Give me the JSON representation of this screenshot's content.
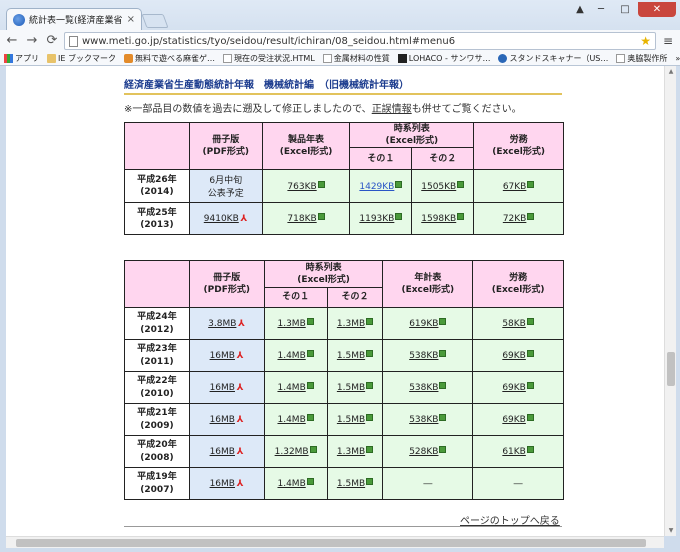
{
  "browser": {
    "tab_title": "統計表一覧(経済産業省生",
    "tab_close": "×",
    "url": "www.meti.go.jp/statistics/tyo/seidou/result/ichiran/08_seidou.html#menu6",
    "bookmarks": [
      "アプリ",
      "IE ブックマーク",
      "無料で遊べる麻雀ゲ…",
      "現在の受注状況.HTML",
      "金属材料の性質",
      "LOHACO - サンワサ…",
      "スタンドスキャナー（US…",
      "奥脇製作所"
    ],
    "bookmarks_more": "»"
  },
  "page": {
    "heading": "経済産業省生産動態統計年報　機械統計編　（旧機械統計年報）",
    "note_before": "※一部品目の数値を過去に遡及して修正しましたので、",
    "note_link": "正誤情報",
    "note_after": "も併せてご覧ください。",
    "top_link": "ページのトップへ戻る"
  },
  "table1": {
    "headers": {
      "pdf": [
        "冊子版",
        "(PDF形式)"
      ],
      "products": [
        "製品年表",
        "(Excel形式)"
      ],
      "timeseries": [
        "時系列表",
        "(Excel形式)"
      ],
      "ts1": "その１",
      "ts2": "その２",
      "labor": [
        "労務",
        "(Excel形式)"
      ]
    },
    "rows": [
      {
        "year": [
          "平成26年",
          "(2014)"
        ],
        "pdf_text": [
          "6月中旬",
          "公表予定"
        ],
        "products": "763KB",
        "ts1": "1429KB",
        "ts2": "1505KB",
        "labor": "67KB"
      },
      {
        "year": [
          "平成25年",
          "(2013)"
        ],
        "pdf": "9410KB",
        "products": "718KB",
        "ts1": "1193KB",
        "ts2": "1598KB",
        "labor": "72KB"
      }
    ]
  },
  "table2": {
    "headers": {
      "pdf": [
        "冊子版",
        "(PDF形式)"
      ],
      "timeseries": [
        "時系列表",
        "(Excel形式)"
      ],
      "ts1": "その１",
      "ts2": "その２",
      "annual": [
        "年計表",
        "(Excel形式)"
      ],
      "labor": [
        "労務",
        "(Excel形式)"
      ]
    },
    "rows": [
      {
        "year": [
          "平成24年",
          "(2012)"
        ],
        "pdf": "3.8MB",
        "ts1": "1.3MB",
        "ts2": "1.3MB",
        "annual": "619KB",
        "labor": "58KB"
      },
      {
        "year": [
          "平成23年",
          "(2011)"
        ],
        "pdf": "16MB",
        "ts1": "1.4MB",
        "ts2": "1.5MB",
        "annual": "538KB",
        "labor": "69KB"
      },
      {
        "year": [
          "平成22年",
          "(2010)"
        ],
        "pdf": "16MB",
        "ts1": "1.4MB",
        "ts2": "1.5MB",
        "annual": "538KB",
        "labor": "69KB"
      },
      {
        "year": [
          "平成21年",
          "(2009)"
        ],
        "pdf": "16MB",
        "ts1": "1.4MB",
        "ts2": "1.5MB",
        "annual": "538KB",
        "labor": "69KB"
      },
      {
        "year": [
          "平成20年",
          "(2008)"
        ],
        "pdf": "16MB",
        "ts1": "1.32MB",
        "ts2": "1.3MB",
        "annual": "528KB",
        "labor": "61KB"
      },
      {
        "year": [
          "平成19年",
          "(2007)"
        ],
        "pdf": "16MB",
        "ts1": "1.4MB",
        "ts2": "1.5MB",
        "annual": "―",
        "labor": "―"
      }
    ]
  }
}
